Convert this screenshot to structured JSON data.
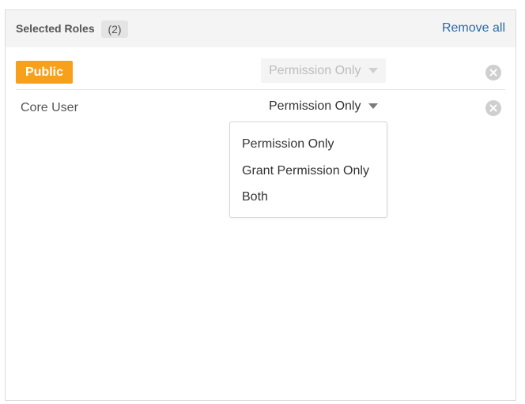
{
  "header": {
    "title": "Selected Roles",
    "count": "(2)",
    "remove_all": "Remove all"
  },
  "roles": [
    {
      "label": "Public",
      "permission": "Permission Only",
      "disabled": true
    },
    {
      "label": "Core User",
      "permission": "Permission Only",
      "disabled": false
    }
  ],
  "dropdown": {
    "options": [
      "Permission Only",
      "Grant Permission Only",
      "Both"
    ]
  },
  "colors": {
    "accent": "#f7a01c",
    "link": "#2d6aa6",
    "header_bg": "#f4f4f4"
  }
}
